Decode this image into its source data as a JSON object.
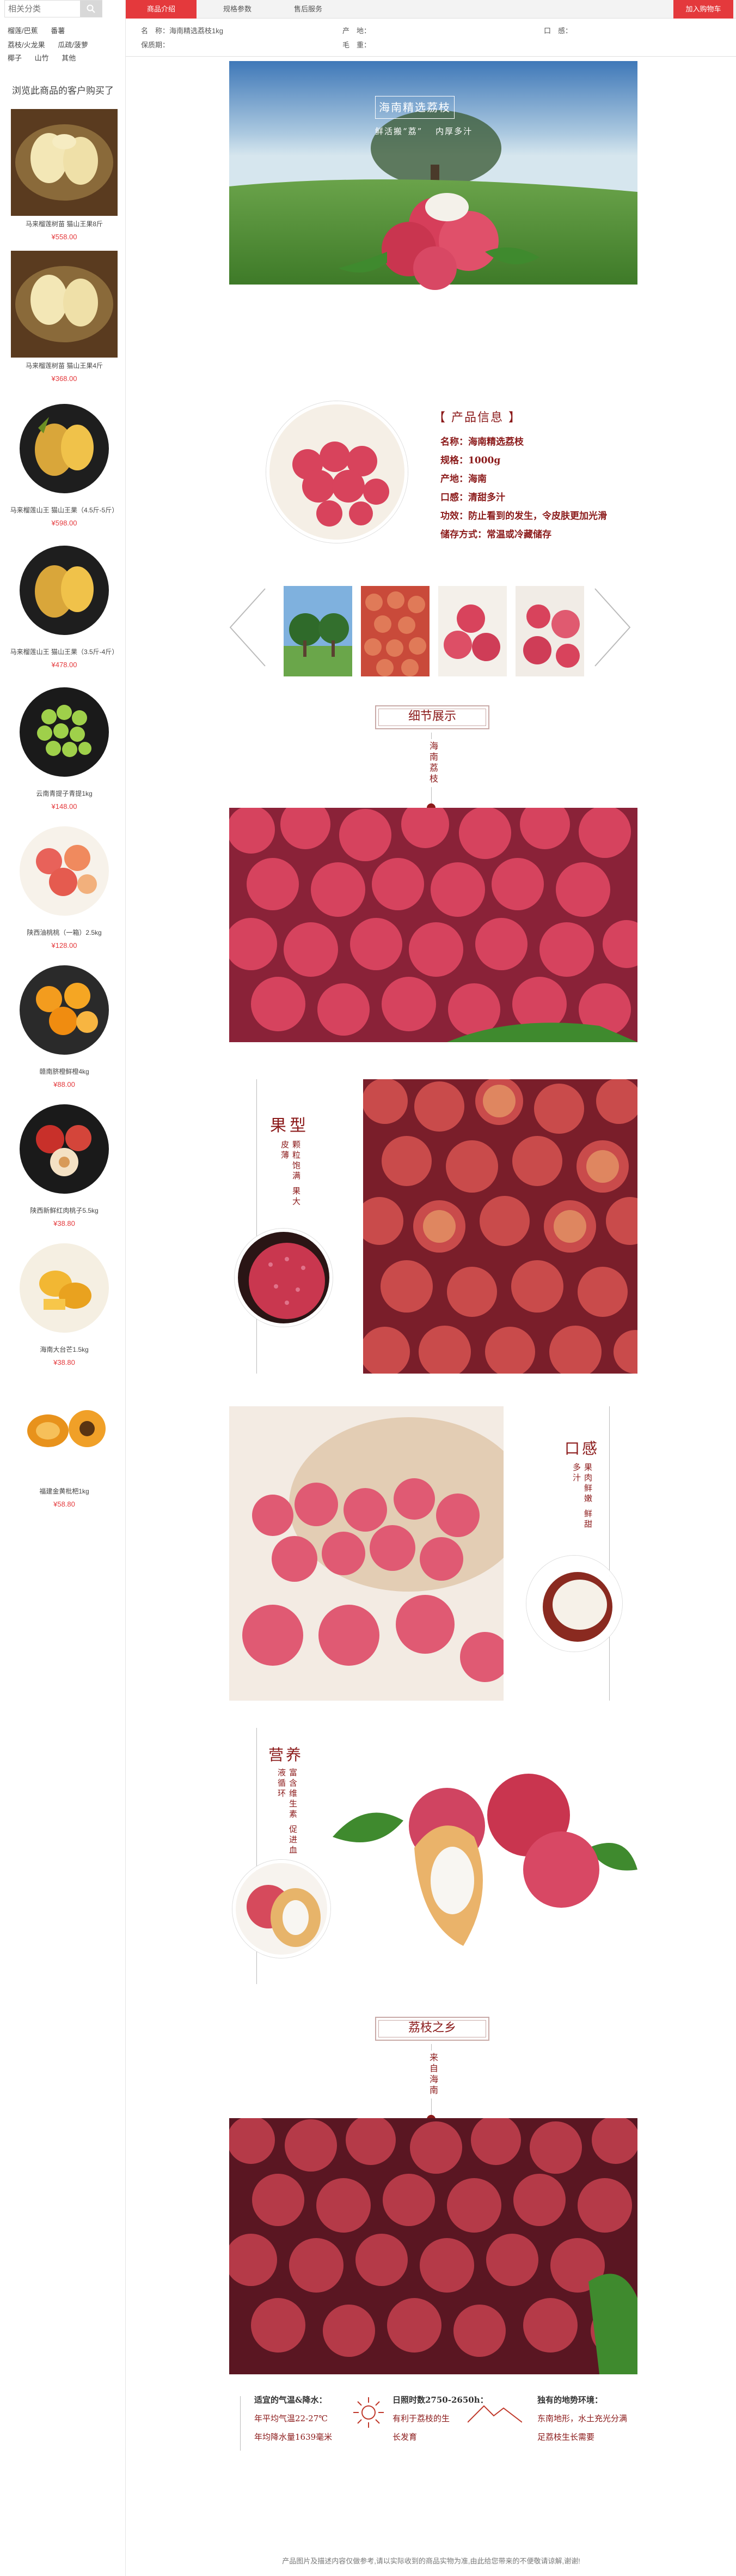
{
  "sidebar": {
    "search": {
      "placeholder": "相关分类"
    },
    "categories": [
      [
        "榴莲/巴蕉",
        "番薯"
      ],
      [
        "荔枝/火龙果",
        "瓜疏/菠萝"
      ],
      [
        "椰子",
        "山竹",
        "其他"
      ]
    ],
    "bought_title": "浏览此商品的客户购买了",
    "products": [
      {
        "name": "马来榴莲树苗 猫山王果8斤",
        "price": "¥558.00"
      },
      {
        "name": "马来榴莲树苗 猫山王果4斤",
        "price": "¥368.00"
      },
      {
        "name": "马来榴莲山王 猫山王果（4.5斤-5斤）",
        "price": "¥598.00"
      },
      {
        "name": "马来榴莲山王 猫山王果（3.5斤-4斤）",
        "price": "¥478.00"
      },
      {
        "name": "云南青提子青提1kg",
        "price": "¥148.00"
      },
      {
        "name": "陕西油桃桃（一箱）2.5kg",
        "price": "¥128.00"
      },
      {
        "name": "赣南脐橙鲜橙4kg",
        "price": "¥88.00"
      },
      {
        "name": "陕西新鲜红肉桃子5.5kg",
        "price": "¥38.80"
      },
      {
        "name": "海南大台芒1.5kg",
        "price": "¥38.80"
      },
      {
        "name": "福建金黄枇杷1kg",
        "price": "¥58.80"
      }
    ]
  },
  "tabs": [
    {
      "label": "商品介绍"
    },
    {
      "label": "规格参数"
    },
    {
      "label": "售后服务"
    }
  ],
  "cart_button": "加入购物车",
  "params": {
    "brand": "品　牌：",
    "name": "名　称：海南精选荔枝1kg",
    "origin": "产　地：",
    "taste": "口　感：",
    "shelf": "保质期：",
    "weight": "毛　重："
  },
  "banner": {
    "title": "海南精选荔枝",
    "subtitle": "鲜活搬“荔” 　内厚多汁"
  },
  "product_info": {
    "heading": "【 产品信息 】",
    "lines": [
      "名称：海南精选荔枝",
      "规格：1000g",
      "产地：海南",
      "口感：清甜多汁",
      "功效：防止看到的发生，令皮肤更加光滑",
      "储存方式：常温或冷藏储存"
    ]
  },
  "sections": {
    "detail_title": "细节展示",
    "detail_vertical": "海南荔枝",
    "shape_title": "果型",
    "shape_text": "颗粒饱满 果大皮薄",
    "taste_title": "口感",
    "taste_text": "果肉鲜嫩 鲜甜多汁",
    "nutrition_title": "营养",
    "nutrition_text": "富含维生素 促进血液循环",
    "hometown_title": "荔枝之乡",
    "hometown_vertical": "来自海南"
  },
  "climate": [
    {
      "title": "适宜的气温&降水：",
      "lines": [
        "年平均气温22-27℃",
        "年均降水量1639毫米"
      ]
    },
    {
      "title": "日照时数2750-2650h：",
      "lines": [
        "有利于荔枝的生",
        "长发育"
      ]
    },
    {
      "title": "独有的地势环境：",
      "lines": [
        "东南地形，水土充光分满",
        "足荔枝生长需要"
      ]
    }
  ],
  "footer_note": "产品图片及描述内容仅做参考,请以实际收到的商品实物为准,由此给您带来的不便敬请谅解,谢谢!",
  "colors": {
    "accent": "#e4393c",
    "maroon": "#8b1a1a"
  }
}
